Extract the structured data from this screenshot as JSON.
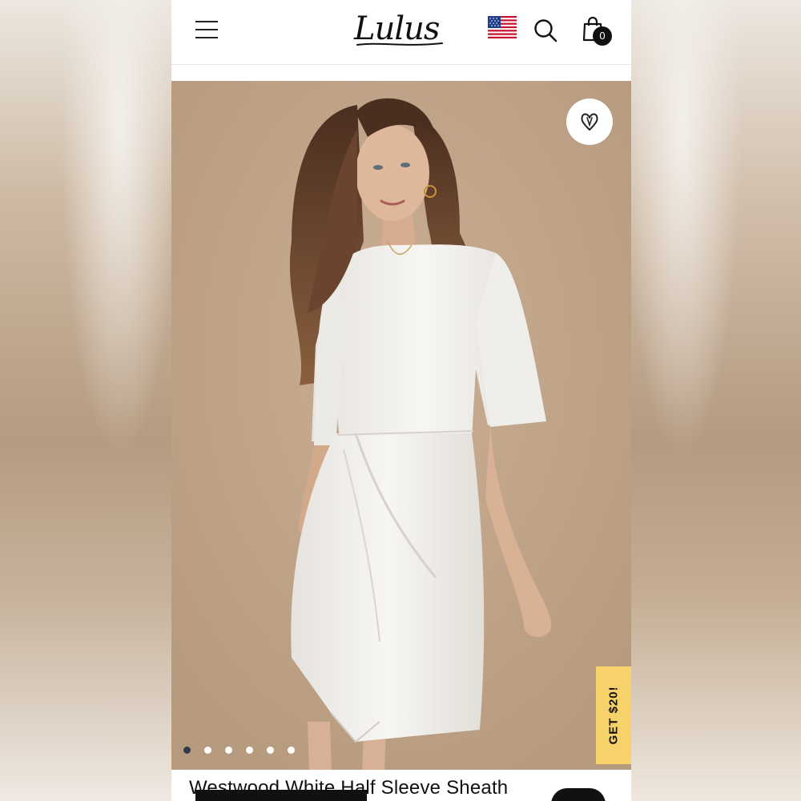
{
  "header": {
    "logo_text": "Lulus",
    "cart_count": "0",
    "icons": [
      "menu-icon",
      "us-flag-icon",
      "search-icon",
      "shopping-bag-icon"
    ]
  },
  "hero": {
    "image_alt": "Model wearing white half sleeve sheath dress",
    "wishlist_icon": "heart-icon",
    "promo_label": "GET $20!",
    "carousel_dots": 6,
    "active_dot": 0
  },
  "product": {
    "title": "Westwood White Half Sleeve Sheath"
  },
  "colors": {
    "backdrop": "#bea286",
    "promo": "#f7d26a",
    "active_dot": "#2f3a4f",
    "dress": "#f4f2ee"
  }
}
